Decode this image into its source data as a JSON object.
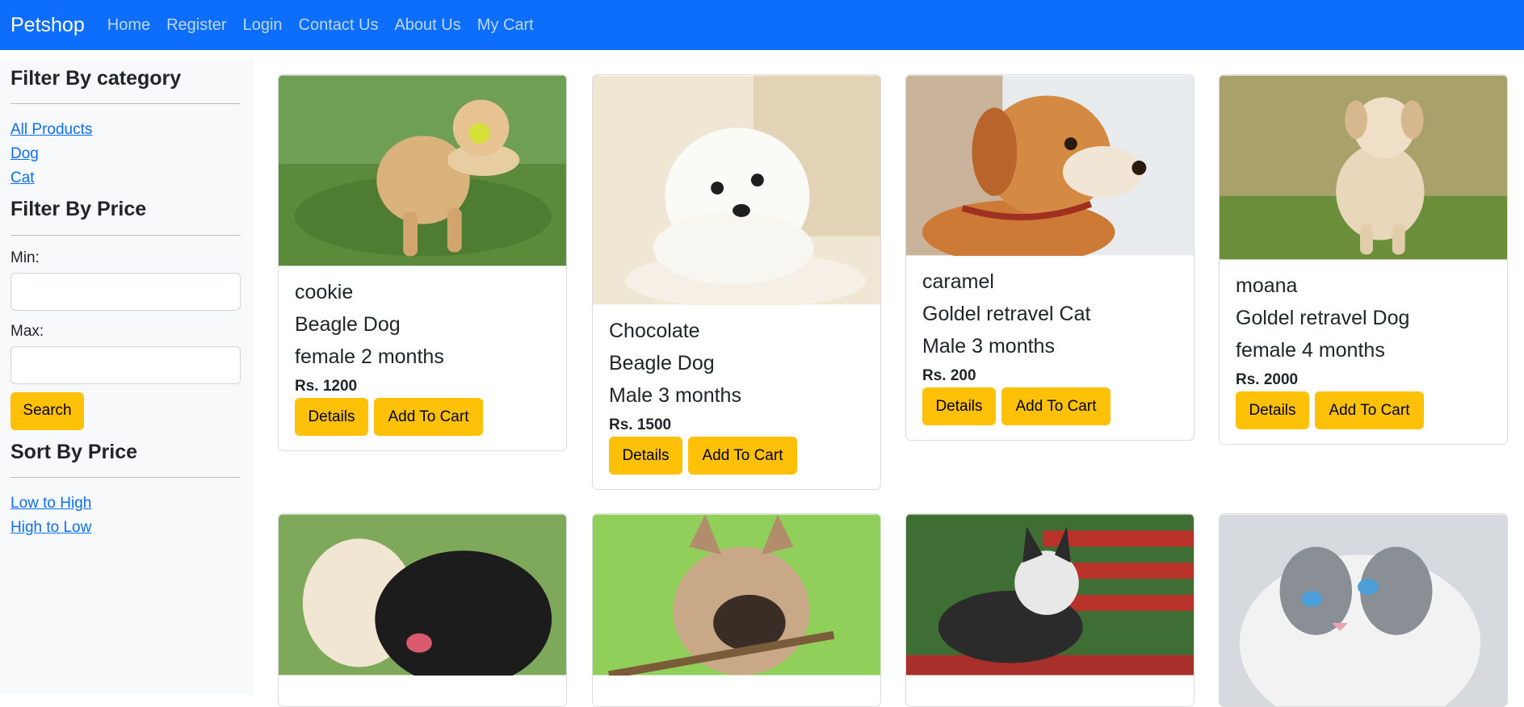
{
  "navbar": {
    "brand": "Petshop",
    "links": [
      "Home",
      "Register",
      "Login",
      "Contact Us",
      "About Us",
      "My Cart"
    ]
  },
  "sidebar": {
    "category_heading": "Filter By category",
    "categories": [
      "All Products",
      "Dog",
      "Cat"
    ],
    "price_heading": "Filter By Price",
    "min_label": "Min:",
    "max_label": "Max:",
    "search_label": "Search",
    "sort_heading": "Sort By Price",
    "sort_links": [
      "Low to High",
      "High to Low"
    ]
  },
  "products": [
    {
      "name": "cookie",
      "breed": "Beagle Dog",
      "info": "female 2 months",
      "price": "Rs. 1200",
      "details_label": "Details",
      "cart_label": "Add To Cart",
      "image": "golden-retriever-with-ball-icon"
    },
    {
      "name": "Chocolate",
      "breed": "Beagle Dog",
      "info": "Male 3 months",
      "price": "Rs. 1500",
      "details_label": "Details",
      "cart_label": "Add To Cart",
      "image": "white-puppy-icon"
    },
    {
      "name": "caramel",
      "breed": "Goldel retravel Cat",
      "info": "Male 3 months",
      "price": "Rs. 200",
      "details_label": "Details",
      "cart_label": "Add To Cart",
      "image": "orange-puppy-icon"
    },
    {
      "name": "moana",
      "breed": "Goldel retravel Dog",
      "info": "female 4 months",
      "price": "Rs. 2000",
      "details_label": "Details",
      "cart_label": "Add To Cart",
      "image": "golden-puppy-running-icon"
    }
  ],
  "second_row_images": [
    "labradors-icon",
    "french-bulldog-icon",
    "husky-on-bench-icon",
    "ragdoll-cat-icon"
  ],
  "colors": {
    "navbar": "#0d6efd",
    "button": "#ffc107",
    "sidebar": "#f8f9fa"
  }
}
